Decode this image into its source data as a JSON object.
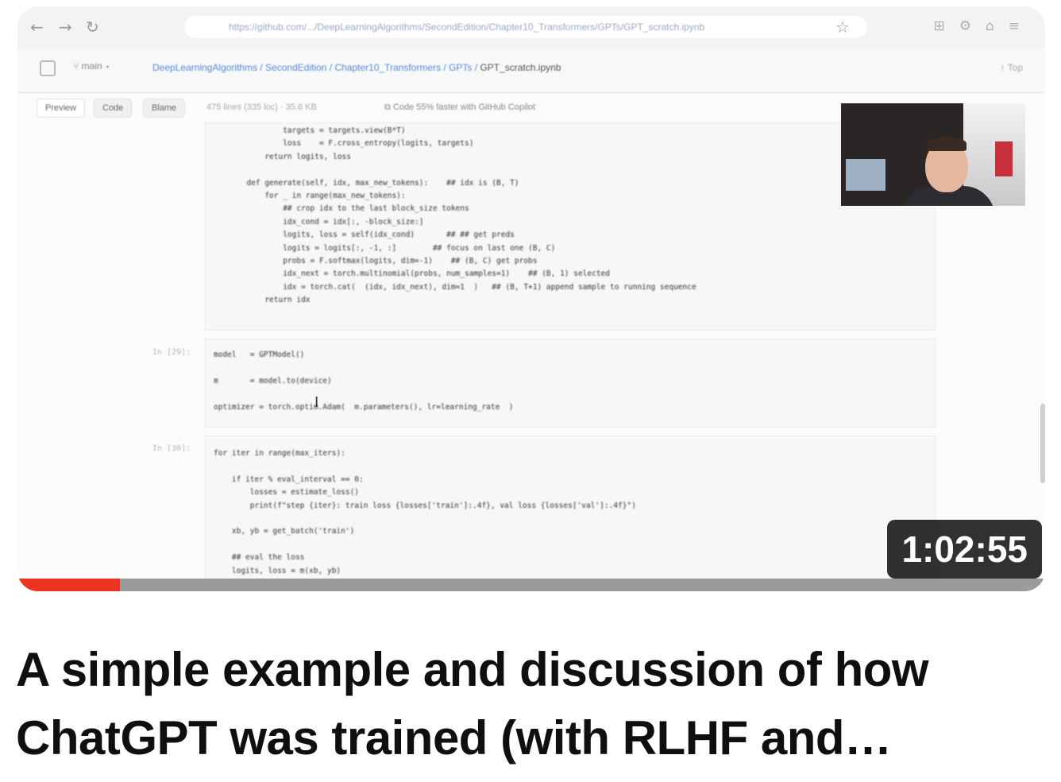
{
  "video": {
    "title": "A simple example and discussion of how ChatGPT was trained (with RLHF and…",
    "duration": "1:02:55",
    "watched_fraction": 0.1,
    "progress_color": "#ea3323"
  },
  "browser": {
    "back_icon": "arrow-left-icon",
    "forward_icon": "arrow-right-icon",
    "reload_icon": "reload-icon",
    "url": "https://github.com/.../DeepLearningAlgorithms/SecondEdition/Chapter10_Transformers/GPTs/GPT_scratch.ipynb"
  },
  "repo": {
    "branch": "main",
    "breadcrumb": "DeepLearningAlgorithms / SecondEdition / Chapter10_Transformers / GPTs /",
    "file": "GPT_scratch.ipynb",
    "top_button": "Top"
  },
  "toolbar": {
    "tabs": [
      "Preview",
      "Code",
      "Blame"
    ],
    "info": "475 lines (335 loc) · 35.6 KB",
    "copilot": "Code 55% faster with GitHub Copilot"
  },
  "cells": [
    {
      "prompt": "",
      "code": "          targets = targets.view(B*T)\n          loss    = F.cross_entropy(logits, targets)\n      return logits, loss\n\n  def generate(self, idx, max_new_tokens):    ## idx is (B, T)\n      for _ in range(max_new_tokens):\n          ## crop idx to the last block_size tokens\n          idx_cond = idx[:, -block_size:]\n          logits, loss = self(idx_cond)       ## ## get preds\n          logits = logits[:, -1, :]        ## focus on last one (B, C)\n          probs = F.softmax(logits, dim=-1)    ## (B, C) get probs\n          idx_next = torch.multinomial(probs, num_samples=1)    ## (B, 1) selected\n          idx = torch.cat(  (idx, idx_next), dim=1  )   ## (B, T+1) append sample to running sequence\n      return idx"
    },
    {
      "prompt": "In [29]:",
      "code": "model   = GPTModel()\n\nm       = model.to(device)\n\noptimizer = torch.optim.Adam(  m.parameters(), lr=learning_rate  )"
    },
    {
      "prompt": "In [30]:",
      "code": "for iter in range(max_iters):\n\n    if iter % eval_interval == 0:\n        losses = estimate_loss()\n        print(f\"step {iter}: train loss {losses['train']:.4f}, val loss {losses['val']:.4f}\")\n\n    xb, yb = get_batch('train')\n\n    ## eval the loss\n    logits, loss = m(xb, yb)"
    }
  ],
  "webcam": {
    "icon": "webcam-presenter-icon"
  }
}
